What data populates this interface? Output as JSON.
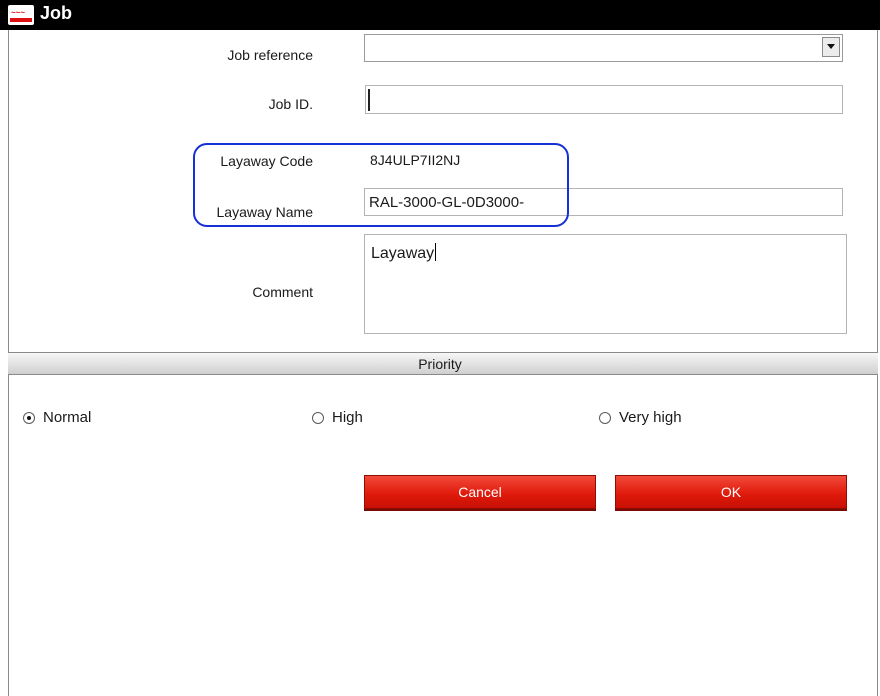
{
  "window": {
    "title": "Job",
    "icon": "app-logo-icon"
  },
  "form": {
    "job_reference": {
      "label": "Job reference",
      "value": ""
    },
    "job_id": {
      "label": "Job ID.",
      "value": ""
    },
    "layaway_code": {
      "label": "Layaway Code",
      "value": "8J4ULP7II2NJ"
    },
    "layaway_name": {
      "label": "Layaway Name",
      "value": "RAL-3000-GL-0D3000-"
    },
    "comment": {
      "label": "Comment",
      "value": "Layaway"
    }
  },
  "priority": {
    "title": "Priority",
    "options": [
      {
        "label": "Normal",
        "selected": true
      },
      {
        "label": "High",
        "selected": false
      },
      {
        "label": "Very high",
        "selected": false
      }
    ]
  },
  "buttons": {
    "cancel": "Cancel",
    "ok": "OK"
  },
  "colors": {
    "title_bar": "#000000",
    "button_red": "#e01b0c",
    "highlight_outline": "#1630d8"
  }
}
